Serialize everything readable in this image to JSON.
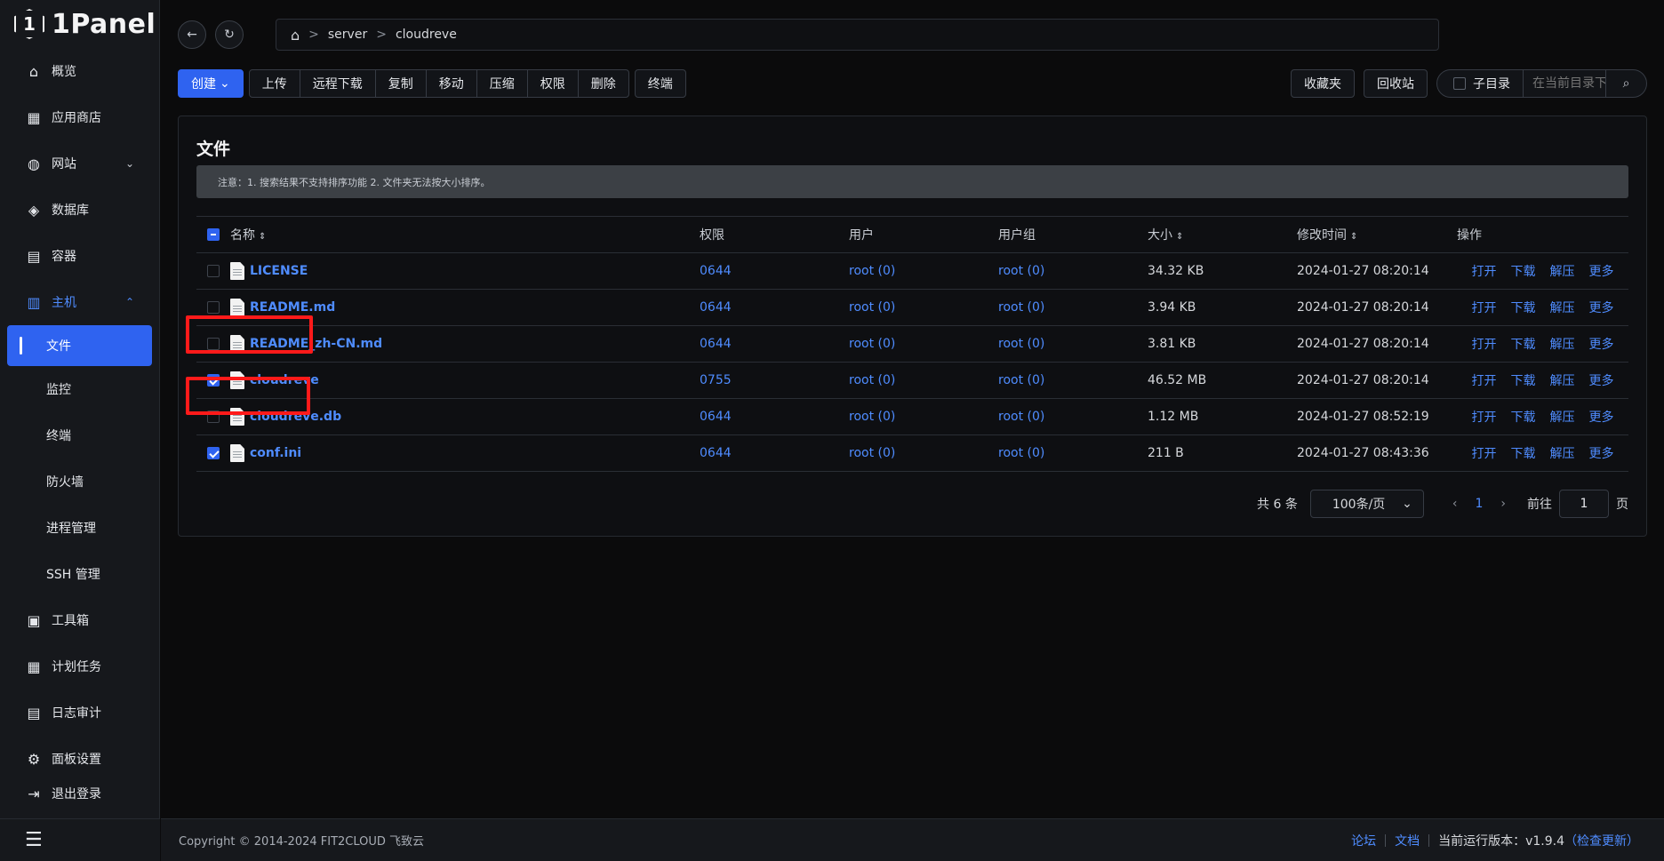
{
  "app": {
    "name": "1Panel",
    "logo_mark": "1"
  },
  "sidebar": {
    "items": [
      {
        "label": "概览",
        "icon": "home-icon"
      },
      {
        "label": "应用商店",
        "icon": "grid-icon"
      },
      {
        "label": "网站",
        "icon": "globe-icon"
      },
      {
        "label": "数据库",
        "icon": "layers-icon"
      },
      {
        "label": "容器",
        "icon": "docker-icon"
      },
      {
        "label": "主机",
        "icon": "server-icon"
      }
    ],
    "host_sub": [
      {
        "label": "文件",
        "active": true
      },
      {
        "label": "监控"
      },
      {
        "label": "终端"
      },
      {
        "label": "防火墙"
      },
      {
        "label": "进程管理"
      },
      {
        "label": "SSH 管理"
      }
    ],
    "items_bottom": [
      {
        "label": "工具箱",
        "icon": "toolbox-icon"
      },
      {
        "label": "计划任务",
        "icon": "calendar-icon"
      },
      {
        "label": "日志审计",
        "icon": "log-icon"
      },
      {
        "label": "面板设置",
        "icon": "gear-icon"
      },
      {
        "label": "退出登录",
        "icon": "logout-icon"
      }
    ]
  },
  "breadcrumb": {
    "items": [
      "server",
      "cloudreve"
    ],
    "sep": ">"
  },
  "toolbar": {
    "create": "创建",
    "actions": [
      "上传",
      "远程下载",
      "复制",
      "移动",
      "压缩",
      "权限",
      "删除"
    ],
    "terminal": "终端",
    "favorites": "收藏夹",
    "recycle": "回收站",
    "subdir": "子目录",
    "search_placeholder": "在当前目录下查找"
  },
  "panel": {
    "title": "文件",
    "notice": "注意：1. 搜索结果不支持排序功能 2. 文件夹无法按大小排序。"
  },
  "table": {
    "headers": {
      "name": "名称",
      "perm": "权限",
      "user": "用户",
      "group": "用户组",
      "size": "大小",
      "time": "修改时间",
      "ops": "操作"
    },
    "ops": [
      "打开",
      "下载",
      "解压",
      "更多"
    ],
    "rows": [
      {
        "name": "LICENSE",
        "perm": "0644",
        "user": "root (0)",
        "group": "root (0)",
        "size": "34.32 KB",
        "time": "2024-01-27 08:20:14",
        "checked": false
      },
      {
        "name": "README.md",
        "perm": "0644",
        "user": "root (0)",
        "group": "root (0)",
        "size": "3.94 KB",
        "time": "2024-01-27 08:20:14",
        "checked": false
      },
      {
        "name": "README_zh-CN.md",
        "perm": "0644",
        "user": "root (0)",
        "group": "root (0)",
        "size": "3.81 KB",
        "time": "2024-01-27 08:20:14",
        "checked": false
      },
      {
        "name": "cloudreve",
        "perm": "0755",
        "user": "root (0)",
        "group": "root (0)",
        "size": "46.52 MB",
        "time": "2024-01-27 08:20:14",
        "checked": true
      },
      {
        "name": "cloudreve.db",
        "perm": "0644",
        "user": "root (0)",
        "group": "root (0)",
        "size": "1.12 MB",
        "time": "2024-01-27 08:52:19",
        "checked": false
      },
      {
        "name": "conf.ini",
        "perm": "0644",
        "user": "root (0)",
        "group": "root (0)",
        "size": "211 B",
        "time": "2024-01-27 08:43:36",
        "checked": true
      }
    ]
  },
  "pagination": {
    "total": "共 6 条",
    "page_size": "100条/页",
    "current": "1",
    "goto_label": "前往",
    "goto_value": "1",
    "page_suffix": "页"
  },
  "footer": {
    "copyright": "Copyright © 2014-2024 FIT2CLOUD 飞致云",
    "forum": "论坛",
    "docs": "文档",
    "version": "当前运行版本：v1.9.4",
    "check_update": "（检查更新）"
  },
  "colors": {
    "accent": "#2f63f0",
    "link": "#4f8cff",
    "highlight": "#ff1a1a"
  }
}
